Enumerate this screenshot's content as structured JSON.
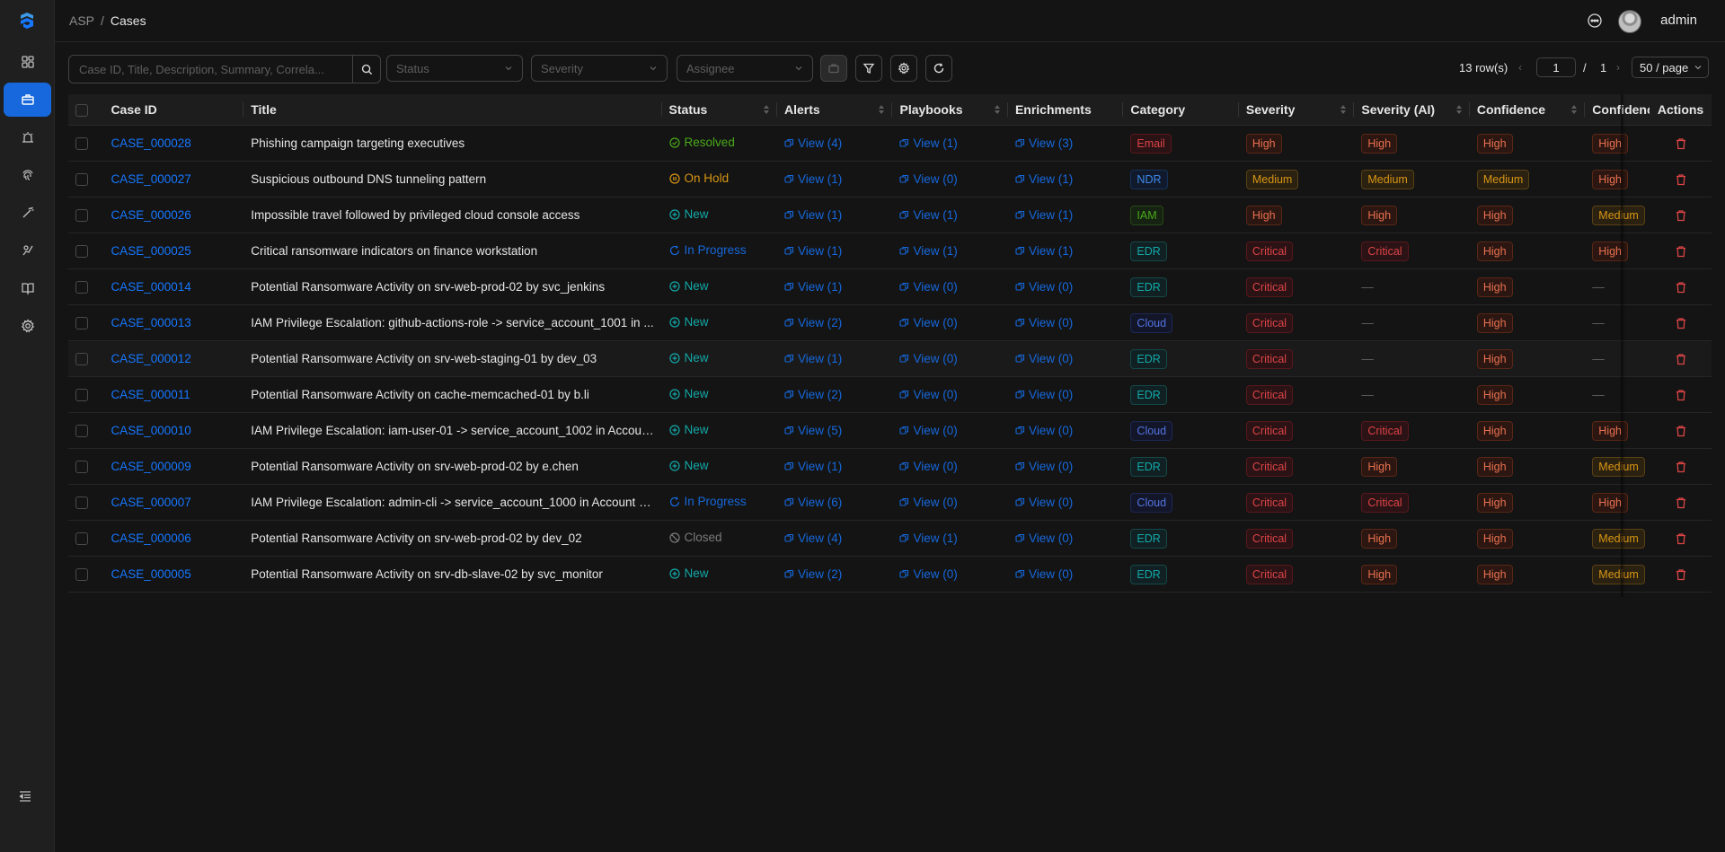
{
  "breadcrumb": {
    "root": "ASP",
    "separator": "/",
    "current": "Cases"
  },
  "user": {
    "name": "admin"
  },
  "sidebar": {
    "items": [
      {
        "name": "dashboard-icon"
      },
      {
        "name": "cases-icon",
        "active": true
      },
      {
        "name": "alerts-icon"
      },
      {
        "name": "fingerprint-icon"
      },
      {
        "name": "magic-wand-icon"
      },
      {
        "name": "knowledge-icon"
      },
      {
        "name": "book-icon"
      },
      {
        "name": "settings-icon"
      }
    ]
  },
  "toolbar": {
    "search_placeholder": "Case ID, Title, Description, Summary, Correla...",
    "status_placeholder": "Status",
    "severity_placeholder": "Severity",
    "assignee_placeholder": "Assignee"
  },
  "pagination": {
    "row_count": "13 row(s)",
    "current_page": "1",
    "separator": "/",
    "total_pages": "1",
    "page_size": "50 / page"
  },
  "columns": {
    "case_id": "Case ID",
    "title": "Title",
    "status": "Status",
    "alerts": "Alerts",
    "playbooks": "Playbooks",
    "enrichments": "Enrichments",
    "category": "Category",
    "severity": "Severity",
    "severity_ai": "Severity (AI)",
    "confidence": "Confidence",
    "confidence_ai": "Confidence",
    "actions": "Actions"
  },
  "rows": [
    {
      "id": "CASE_000028",
      "title": "Phishing campaign targeting executives",
      "status": "Resolved",
      "alerts": "View (4)",
      "playbooks": "View (1)",
      "enrichments": "View (3)",
      "category": "Email",
      "severity": "High",
      "severity_ai": "High",
      "confidence": "High",
      "confidence_ai": "High"
    },
    {
      "id": "CASE_000027",
      "title": "Suspicious outbound DNS tunneling pattern",
      "status": "On Hold",
      "alerts": "View (1)",
      "playbooks": "View (0)",
      "enrichments": "View (1)",
      "category": "NDR",
      "severity": "Medium",
      "severity_ai": "Medium",
      "confidence": "Medium",
      "confidence_ai": "High"
    },
    {
      "id": "CASE_000026",
      "title": "Impossible travel followed by privileged cloud console access",
      "status": "New",
      "alerts": "View (1)",
      "playbooks": "View (1)",
      "enrichments": "View (1)",
      "category": "IAM",
      "severity": "High",
      "severity_ai": "High",
      "confidence": "High",
      "confidence_ai": "Medium"
    },
    {
      "id": "CASE_000025",
      "title": "Critical ransomware indicators on finance workstation",
      "status": "In Progress",
      "alerts": "View (1)",
      "playbooks": "View (1)",
      "enrichments": "View (1)",
      "category": "EDR",
      "severity": "Critical",
      "severity_ai": "Critical",
      "confidence": "High",
      "confidence_ai": "High"
    },
    {
      "id": "CASE_000014",
      "title": "Potential Ransomware Activity on srv-web-prod-02 by svc_jenkins",
      "status": "New",
      "alerts": "View (1)",
      "playbooks": "View (0)",
      "enrichments": "View (0)",
      "category": "EDR",
      "severity": "Critical",
      "severity_ai": "—",
      "confidence": "High",
      "confidence_ai": "—"
    },
    {
      "id": "CASE_000013",
      "title": "IAM Privilege Escalation: github-actions-role -> service_account_1001 in ...",
      "status": "New",
      "alerts": "View (2)",
      "playbooks": "View (0)",
      "enrichments": "View (0)",
      "category": "Cloud",
      "severity": "Critical",
      "severity_ai": "—",
      "confidence": "High",
      "confidence_ai": "—"
    },
    {
      "id": "CASE_000012",
      "title": "Potential Ransomware Activity on srv-web-staging-01 by dev_03",
      "status": "New",
      "alerts": "View (1)",
      "playbooks": "View (0)",
      "enrichments": "View (0)",
      "category": "EDR",
      "severity": "Critical",
      "severity_ai": "—",
      "confidence": "High",
      "confidence_ai": "—"
    },
    {
      "id": "CASE_000011",
      "title": "Potential Ransomware Activity on cache-memcached-01 by b.li",
      "status": "New",
      "alerts": "View (2)",
      "playbooks": "View (0)",
      "enrichments": "View (0)",
      "category": "EDR",
      "severity": "Critical",
      "severity_ai": "—",
      "confidence": "High",
      "confidence_ai": "—"
    },
    {
      "id": "CASE_000010",
      "title": "IAM Privilege Escalation: iam-user-01 -> service_account_1002 in Account...",
      "status": "New",
      "alerts": "View (5)",
      "playbooks": "View (0)",
      "enrichments": "View (0)",
      "category": "Cloud",
      "severity": "Critical",
      "severity_ai": "Critical",
      "confidence": "High",
      "confidence_ai": "High"
    },
    {
      "id": "CASE_000009",
      "title": "Potential Ransomware Activity on srv-web-prod-02 by e.chen",
      "status": "New",
      "alerts": "View (1)",
      "playbooks": "View (0)",
      "enrichments": "View (0)",
      "category": "EDR",
      "severity": "Critical",
      "severity_ai": "High",
      "confidence": "High",
      "confidence_ai": "Medium"
    },
    {
      "id": "CASE_000007",
      "title": "IAM Privilege Escalation: admin-cli -> service_account_1000 in Account 1...",
      "status": "In Progress",
      "alerts": "View (6)",
      "playbooks": "View (0)",
      "enrichments": "View (0)",
      "category": "Cloud",
      "severity": "Critical",
      "severity_ai": "Critical",
      "confidence": "High",
      "confidence_ai": "High"
    },
    {
      "id": "CASE_000006",
      "title": "Potential Ransomware Activity on srv-web-prod-02 by dev_02",
      "status": "Closed",
      "alerts": "View (4)",
      "playbooks": "View (1)",
      "enrichments": "View (0)",
      "category": "EDR",
      "severity": "Critical",
      "severity_ai": "High",
      "confidence": "High",
      "confidence_ai": "Medium"
    },
    {
      "id": "CASE_000005",
      "title": "Potential Ransomware Activity on srv-db-slave-02 by svc_monitor",
      "status": "New",
      "alerts": "View (2)",
      "playbooks": "View (0)",
      "enrichments": "View (0)",
      "category": "EDR",
      "severity": "Critical",
      "severity_ai": "High",
      "confidence": "High",
      "confidence_ai": "Medium"
    }
  ]
}
